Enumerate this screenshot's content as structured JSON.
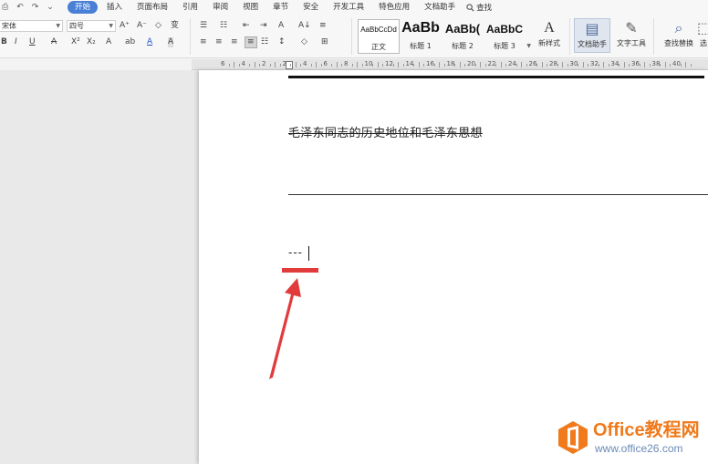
{
  "menubar": {
    "quick_access": [
      "⎙",
      "↶",
      "↷",
      "⌄"
    ],
    "tabs": [
      "开始",
      "插入",
      "页面布局",
      "引用",
      "审阅",
      "视图",
      "章节",
      "安全",
      "开发工具",
      "特色应用",
      "文档助手"
    ],
    "active_tab": "开始",
    "search_label": "查找"
  },
  "ribbon": {
    "font_name": "宋体",
    "font_size": "四号",
    "font_buttons": [
      "A⁺",
      "A⁻",
      "◇",
      "变"
    ],
    "format_buttons": [
      "B",
      "I",
      "U",
      "A",
      "X²",
      "X₂",
      "A",
      "ab",
      "A",
      "A"
    ],
    "para_buttons_row1": [
      "☰",
      "☷",
      "⇤",
      "⇥",
      "A",
      "A↓",
      "≡"
    ],
    "para_buttons_row2": [
      "≡",
      "≡",
      "≡",
      "≡",
      "☷",
      "↕",
      "◇",
      "⊞"
    ],
    "styles": [
      {
        "sample": "AaBbCcDd",
        "name": "正文"
      },
      {
        "sample": "AaBb",
        "name": "标题 1"
      },
      {
        "sample": "AaBb(",
        "name": "标题 2"
      },
      {
        "sample": "AaBbC",
        "name": "标题 3"
      }
    ],
    "new_style_label": "新样式",
    "doc_helper_label": "文档助手",
    "text_tools_label": "文字工具",
    "find_replace_label": "查找替换",
    "select_label": "选"
  },
  "ruler": {
    "numbers": [
      "6",
      "4",
      "2",
      "2",
      "4",
      "6",
      "8",
      "10",
      "12",
      "14",
      "16",
      "18",
      "20",
      "22",
      "24",
      "26",
      "28",
      "30",
      "32",
      "34",
      "36",
      "38",
      "40"
    ]
  },
  "document": {
    "heading": "毛泽东同志的历史地位和毛泽东思想",
    "typed_text": "---"
  },
  "watermark": {
    "title": "Office教程网",
    "url": "www.office26.com"
  },
  "colors": {
    "accent": "#4a7fd6",
    "annotation_red": "#e23b3b",
    "watermark_orange": "#f07a1c"
  }
}
